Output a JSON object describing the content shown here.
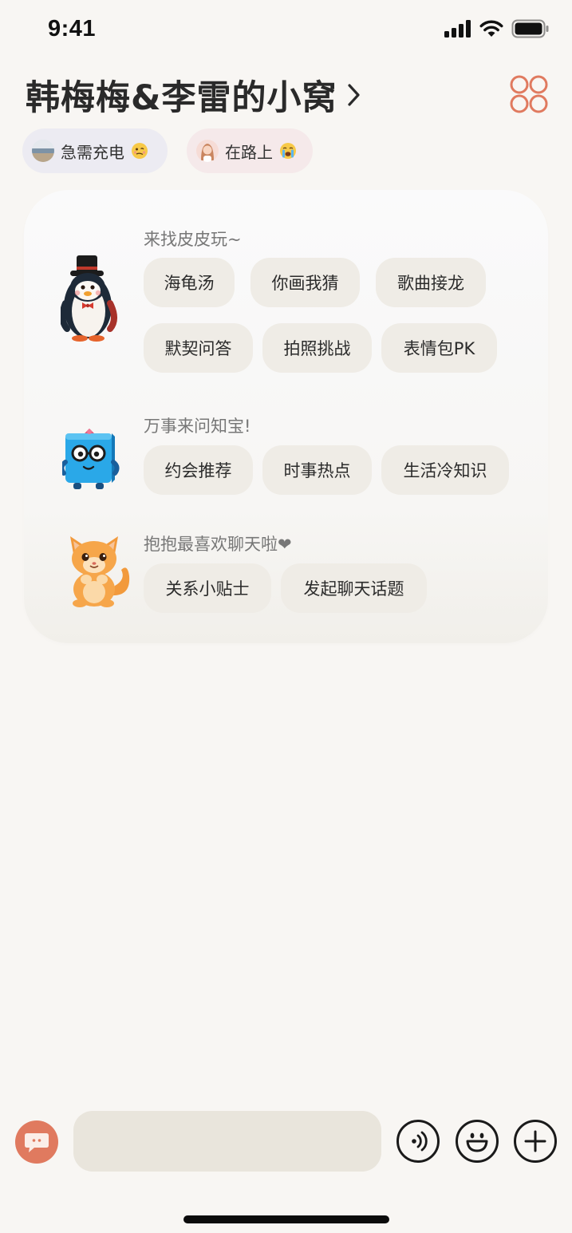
{
  "status_bar": {
    "time": "9:41",
    "icons": [
      "cellular-signal-icon",
      "wifi-icon",
      "battery-icon"
    ]
  },
  "header": {
    "title": "韩梅梅&李雷的小窝",
    "chevron_icon": "chevron-right-icon",
    "menu_icon": "grid-four-circles-icon",
    "accent_color": "#e07a5f"
  },
  "status_chips": [
    {
      "label": "急需充电",
      "avatar": "landscape-avatar",
      "emoji": "woozy-face-emoji"
    },
    {
      "label": "在路上",
      "avatar": "girl-avatar",
      "emoji": "crying-face-emoji"
    }
  ],
  "sections": [
    {
      "mascot": "penguin-with-top-hat",
      "heading": "来找皮皮玩~",
      "rows": [
        [
          "海龟汤",
          "你画我猜",
          "歌曲接龙"
        ],
        [
          "默契问答",
          "拍照挑战",
          "表情包PK"
        ]
      ]
    },
    {
      "mascot": "blue-book-with-glasses",
      "heading": "万事来问知宝!",
      "rows": [
        [
          "约会推荐",
          "时事热点",
          "生活冷知识"
        ]
      ]
    },
    {
      "mascot": "orange-cat",
      "heading": "抱抱最喜欢聊天啦❤",
      "rows": [
        [
          "关系小贴士",
          "发起聊天话题"
        ]
      ]
    }
  ],
  "input_bar": {
    "input_value": "",
    "left_button_icon": "chat-bubble-icon",
    "buttons": [
      "voice-icon",
      "emoji-icon",
      "plus-icon"
    ]
  }
}
